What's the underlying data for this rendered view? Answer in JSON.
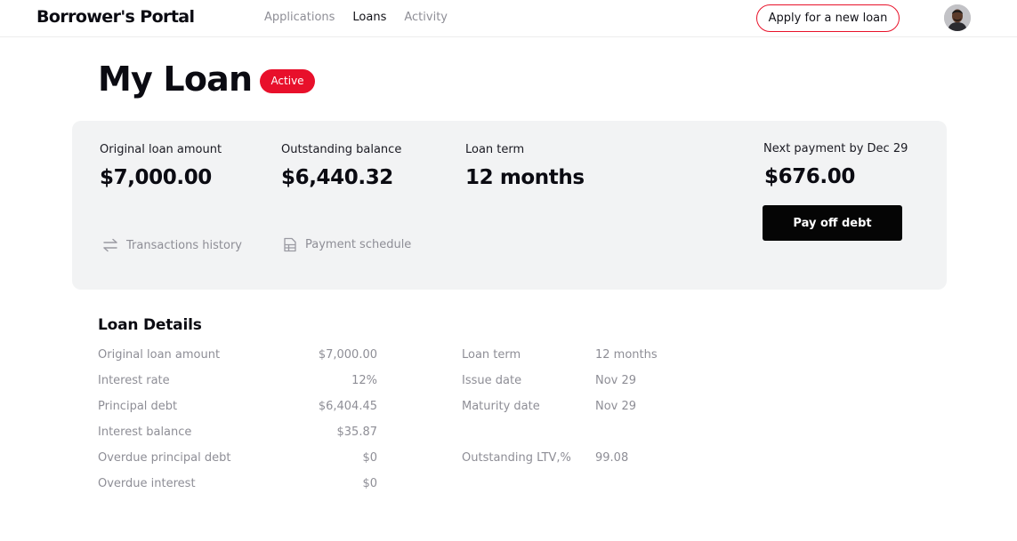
{
  "header": {
    "brand": "Borrower's Portal",
    "nav": [
      {
        "label": "Applications",
        "active": false
      },
      {
        "label": "Loans",
        "active": true
      },
      {
        "label": "Activity",
        "active": false
      }
    ],
    "apply_button": "Apply for a new loan",
    "avatar_icon": "user-avatar",
    "accent_color": "#e8122a"
  },
  "page": {
    "title": "My Loan",
    "status": "Active",
    "status_color": "#e8102b"
  },
  "summary": {
    "original_amount": {
      "label": "Original loan amount",
      "value": "$7,000.00"
    },
    "outstanding_balance": {
      "label": "Outstanding balance",
      "value": "$6,440.32"
    },
    "loan_term": {
      "label": "Loan term",
      "value": "12 months"
    },
    "next_payment": {
      "label": "Next payment by Dec 29",
      "value": "$676.00"
    },
    "payoff_button": "Pay off debt",
    "links": {
      "transactions": {
        "label": "Transactions history",
        "icon": "arrows-exchange-icon"
      },
      "schedule": {
        "label": "Payment schedule",
        "icon": "document-icon"
      }
    }
  },
  "details": {
    "title": "Loan Details",
    "left": [
      {
        "label": "Original loan amount",
        "value": "$7,000.00"
      },
      {
        "label": "Interest rate",
        "value": "12%"
      },
      {
        "label": "Principal debt",
        "value": "$6,404.45"
      },
      {
        "label": "Interest balance",
        "value": "$35.87"
      },
      {
        "label": "Overdue principal debt",
        "value": "$0"
      },
      {
        "label": "Overdue interest",
        "value": "$0"
      }
    ],
    "right": [
      {
        "label": "Loan term",
        "value": "12 months"
      },
      {
        "label": "Issue date",
        "value": "Nov 29"
      },
      {
        "label": "Maturity date",
        "value": "Nov 29"
      },
      {
        "label": "Outstanding LTV,%",
        "value": "99.08"
      }
    ]
  }
}
